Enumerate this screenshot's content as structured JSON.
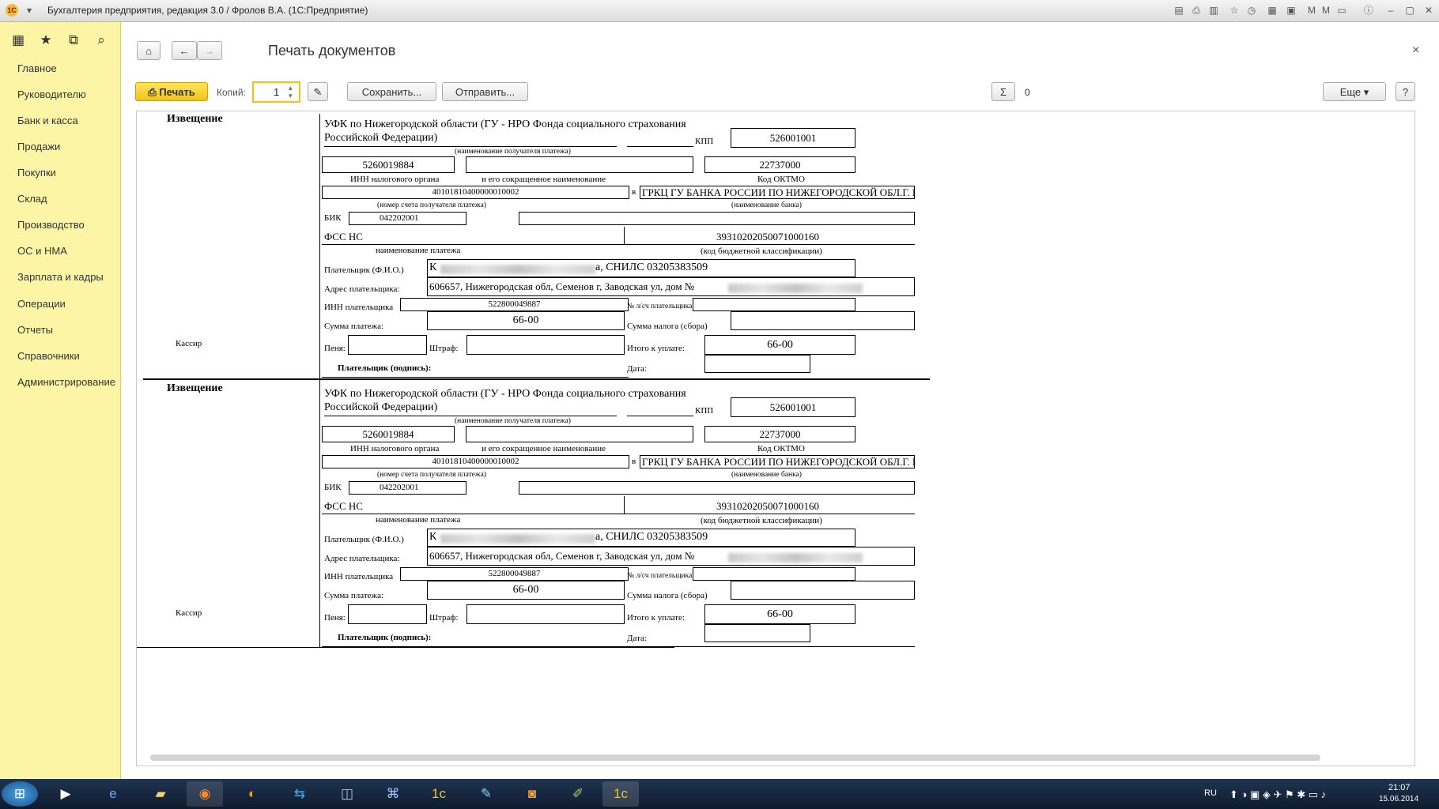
{
  "window": {
    "title": "Бухгалтерия предприятия, редакция 3.0 / Фролов В.А.  (1С:Предприятие)"
  },
  "sidebar": {
    "items": [
      "Главное",
      "Руководителю",
      "Банк и касса",
      "Продажи",
      "Покупки",
      "Склад",
      "Производство",
      "ОС и НМА",
      "Зарплата и кадры",
      "Операции",
      "Отчеты",
      "Справочники",
      "Администрирование"
    ]
  },
  "main": {
    "title": "Печать документов",
    "toolbar": {
      "print": "Печать",
      "copies_label": "Копий:",
      "copies_value": "1",
      "save": "Сохранить...",
      "send": "Отправить...",
      "sum_symbol": "Σ",
      "sum_value": "0",
      "more": "Еще",
      "help": "?"
    }
  },
  "document": {
    "izveschenie": "Извещение",
    "kassir": "Кассир",
    "recipient_line1": "УФК по Нижегородской области (ГУ - НРО Фонда социального страхования",
    "recipient_line2": "Российской Федерации)",
    "kpp_label": "КПП",
    "kpp": "526001001",
    "recipient_caption": "(наименование получателя платежа)",
    "inn": "5260019884",
    "oktmo": "22737000",
    "inn_caption": "ИНН налогового органа",
    "short_name_caption": "и его сокращенное наименование",
    "oktmo_caption": "Код ОКТМО",
    "account": "40101810400000010002",
    "v_label": "в",
    "bank": "ГРКЦ ГУ БАНКА РОССИИ ПО НИЖЕГОРОДСКОЙ ОБЛ.Г. НИЖ",
    "account_caption": "(номер счета получателя платежа)",
    "bank_caption": "(наименование банка)",
    "bik_label": "БИК",
    "bik": "042202001",
    "payment_name": "ФСС НС",
    "kbk": "39310202050071000160",
    "payment_name_caption": "наименование платежа",
    "kbk_caption": "(код бюджетной классификации)",
    "payer_label": "Плательщик (Ф.И.О.)",
    "payer_prefix": "К",
    "payer_suffix": "а, СНИЛС 03205383509",
    "address_label": "Адрес плательщика:",
    "address": "606657, Нижегородская обл, Семенов г, Заводская ул, дом №",
    "payer_inn_label": "ИНН плательщика",
    "payer_inn": "522800049887",
    "ls_label": "№ л/сч плательщика",
    "sum_label": "Сумма платежа:",
    "sum": "66-00",
    "tax_label": "Сумма налога (сбора)",
    "penalty_label": "Пеня:",
    "fine_label": "Штраф:",
    "total_label": "Итого к уплате:",
    "total": "66-00",
    "signature_label": "Плательщик (подпись):",
    "date_label": "Дата:"
  },
  "taskbar": {
    "lang": "RU",
    "time": "21:07",
    "date": "15.06.2014"
  }
}
